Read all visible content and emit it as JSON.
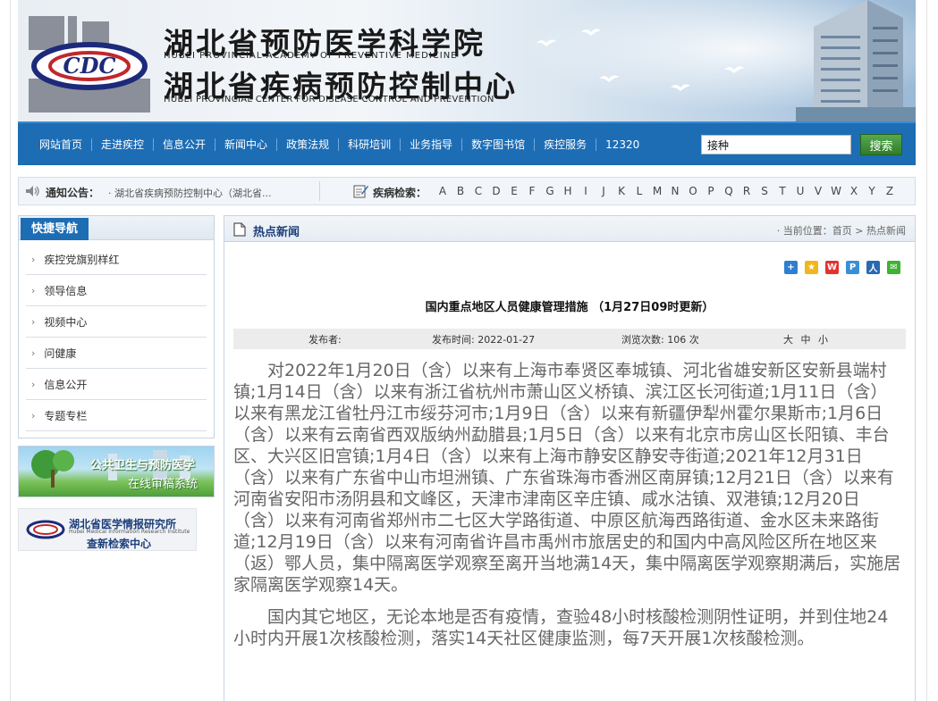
{
  "banner": {
    "title_cn_1": "湖北省预防医学科学院",
    "title_en_1": "HUBEI PROVINCIAL ACADEMY OF PREVENTIVE MEDICINE",
    "title_cn_2": "湖北省疾病预防控制中心",
    "title_en_2": "HUBEI PROVINCIAL CENTER FOR DISEASE CONTROL AND PREVENTION",
    "logo_text": "CDC"
  },
  "nav": {
    "items": [
      "网站首页",
      "走进疾控",
      "信息公开",
      "新闻中心",
      "政策法规",
      "科研培训",
      "业务指导",
      "数字图书馆",
      "疾控服务",
      "12320"
    ],
    "search_value": "接种",
    "search_button": "搜索"
  },
  "notice": {
    "label": "通知公告：",
    "text": "· 湖北省疾病预防控制中心（湖北省...",
    "disease_label": "疾病检索：",
    "letters": [
      "A",
      "B",
      "C",
      "D",
      "E",
      "F",
      "G",
      "H",
      "I",
      "J",
      "K",
      "L",
      "M",
      "N",
      "O",
      "P",
      "Q",
      "R",
      "S",
      "T",
      "U",
      "V",
      "W",
      "X",
      "Y",
      "Z"
    ]
  },
  "sidebar": {
    "title": "快捷导航",
    "items": [
      "疾控党旗别样红",
      "领导信息",
      "视频中心",
      "问健康",
      "信息公开",
      "专题专栏"
    ],
    "promo1_line1": "公共卫生与预防医学",
    "promo1_line2": "在线审稿系统",
    "promo2_line1": "湖北省医学情报研究所",
    "promo2_line2": "Hubei Medical Information Research Institute",
    "promo2_line3": "查新检索中心"
  },
  "main": {
    "section_title": "热点新闻",
    "breadcrumb_prefix": "· 当前位置：",
    "breadcrumb_home": "首页",
    "breadcrumb_sep": ">",
    "breadcrumb_current": "热点新闻",
    "article_title": "国内重点地区人员健康管理措施 （1月27日09时更新）",
    "publisher_label": "发布者:",
    "publish_time": "发布时间: 2022-01-27",
    "views": "浏览次数: 106 次",
    "font_sizes": [
      "大",
      "中",
      "小"
    ],
    "paragraphs": [
      "对2022年1月20日（含）以来有上海市奉贤区奉城镇、河北省雄安新区安新县端村镇;1月14日（含）以来有浙江省杭州市萧山区义桥镇、滨江区长河街道;1月11日（含）以来有黑龙江省牡丹江市绥芬河市;1月9日（含）以来有新疆伊犁州霍尔果斯市;1月6日（含）以来有云南省西双版纳州勐腊县;1月5日（含）以来有北京市房山区长阳镇、丰台区、大兴区旧宫镇;1月4日（含）以来有上海市静安区静安寺街道;2021年12月31日（含）以来有广东省中山市坦洲镇、广东省珠海市香洲区南屏镇;12月21日（含）以来有河南省安阳市汤阴县和文峰区，天津市津南区辛庄镇、咸水沽镇、双港镇;12月20日（含）以来有河南省郑州市二七区大学路街道、中原区航海西路街道、金水区未来路街道;12月19日（含）以来有河南省许昌市禹州市旅居史的和国内中高风险区所在地区来（返）鄂人员，集中隔离医学观察至离开当地满14天，集中隔离医学观察期满后，实施居家隔离医学观察14天。",
      "国内其它地区，无论本地是否有疫情，查验48小时核酸检测阴性证明，并到住地24小时内开展1次核酸检测，落实14天社区健康监测，每7天开展1次核酸检测。"
    ]
  },
  "colors": {
    "nav_blue": "#1d6db5",
    "search_green": "#3a8a33"
  }
}
